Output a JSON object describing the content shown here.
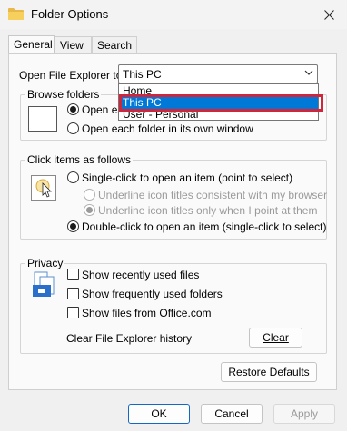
{
  "window": {
    "title": "Folder Options"
  },
  "tabs": [
    {
      "label": "General",
      "active": true
    },
    {
      "label": "View",
      "active": false
    },
    {
      "label": "Search",
      "active": false
    }
  ],
  "open_explorer": {
    "label": "Open File Explorer to:",
    "value": "This PC",
    "options": [
      "Home",
      "This PC",
      "User - Personal"
    ],
    "selected_option": "This PC"
  },
  "browse_folders": {
    "title": "Browse folders",
    "option_same": "Open each folder in the same window",
    "option_same_visible": "Open ea",
    "option_own": "Open each folder in its own window"
  },
  "click_items": {
    "title": "Click items as follows",
    "single_click": "Single-click to open an item (point to select)",
    "underline_consistent": "Underline icon titles consistent with my browser",
    "underline_point": "Underline icon titles only when I point at them",
    "double_click": "Double-click to open an item (single-click to select)"
  },
  "privacy": {
    "title": "Privacy",
    "show_recent_files": "Show recently used files",
    "show_frequent_folders": "Show frequently used folders",
    "show_office_files": "Show files from Office.com",
    "clear_history_label": "Clear File Explorer history",
    "clear_button": "Clear"
  },
  "buttons": {
    "restore_defaults": "Restore Defaults",
    "ok": "OK",
    "cancel": "Cancel",
    "apply": "Apply"
  },
  "colors": {
    "selection": "#0078d7",
    "highlight_outline": "#d0263b",
    "default_button_border": "#1467c2"
  }
}
